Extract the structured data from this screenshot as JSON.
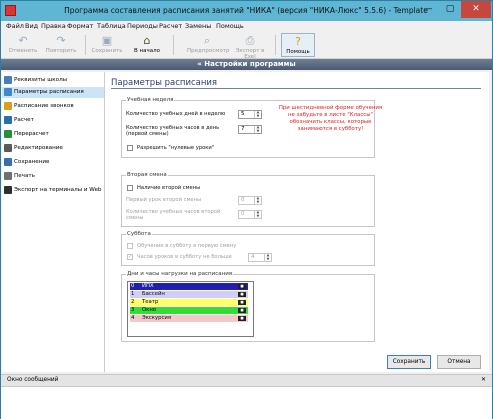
{
  "window": {
    "title": "Программа составления расписания занятий \"НИКА\" (версия \"НИКА-Люкс\" 5.5.6) - Template",
    "minimize": "—",
    "maximize": "▢",
    "close": "✕"
  },
  "menu": [
    "Файл",
    "Вид",
    "Правка",
    "Формат",
    "Таблица",
    "Периоды",
    "Расчет",
    "Замены",
    "Помощь"
  ],
  "toolbar": {
    "undo": "Отменить",
    "redo": "Повторить",
    "save": "Сохранить",
    "home": "В начало",
    "preview": "Предпросмотр",
    "print": "Экспорт в Exel",
    "help": "Помощь"
  },
  "header": "Настройки программы",
  "nav": {
    "items": [
      {
        "label": "Реквизиты школы",
        "color": "#4a7cc0"
      },
      {
        "label": "Параметры расписания",
        "color": "#3a8acc"
      },
      {
        "label": "Расписание звонков",
        "color": "#d6a020"
      },
      {
        "label": "Расчет",
        "color": "#2a6fa8"
      },
      {
        "label": "Перерасчет",
        "color": "#2a8f3a"
      },
      {
        "label": "Редактирование",
        "color": "#5a5a5a"
      },
      {
        "label": "Сохранение",
        "color": "#3a6cb0"
      },
      {
        "label": "Печать",
        "color": "#707070"
      },
      {
        "label": "Экспорт на терминалы и Web",
        "color": "#2f2f2f"
      }
    ]
  },
  "page": {
    "title": "Параметры расписания",
    "week": {
      "label": "Учебная неделя",
      "days_label": "Количество учебных дней в неделю",
      "days_value": "5",
      "hours_label": "Количество учебных часов в день (первой смены)",
      "hours_value": "7",
      "allow_empty_label": "Разрешить \"нулевые уроки\""
    },
    "note": "При шестидневной форме обучения не забудьте в листе \"Классы\" обозначить классы, которые занимаются в субботу!",
    "second_shift": {
      "label": "Вторая смена",
      "has_label": "Наличие второй смены",
      "first_lesson_label": "Первый урок второй смены",
      "first_lesson_value": "0",
      "hours_label": "Количество учебных часов второй смены",
      "hours_value": "0"
    },
    "saturday": {
      "label": "Суббота",
      "first_shift_label": "Обучение в субботу в первую смену",
      "max_hours_label": "Часов уроков в субботу не больше",
      "max_hours_value": "4"
    },
    "days_hours": {
      "label": "Дни и часы нагрузки на расписания",
      "rows": [
        {
          "num": "0",
          "name": "ИПХ",
          "bg": "#2020b0",
          "fg": "#ffffff"
        },
        {
          "num": "1",
          "name": "Бассейн",
          "bg": "#cfcffa",
          "fg": "#000000"
        },
        {
          "num": "2",
          "name": "Театр",
          "bg": "#ffff66",
          "fg": "#000000"
        },
        {
          "num": "3",
          "name": "Окно",
          "bg": "#33dd33",
          "fg": "#000000"
        },
        {
          "num": "4",
          "name": "Экскурсия",
          "bg": "#f4c8c8",
          "fg": "#000000"
        }
      ]
    }
  },
  "buttons": {
    "save": "Сохранить",
    "cancel": "Отмена"
  },
  "messages": {
    "title": "Окно сообщений",
    "close": "✕"
  }
}
